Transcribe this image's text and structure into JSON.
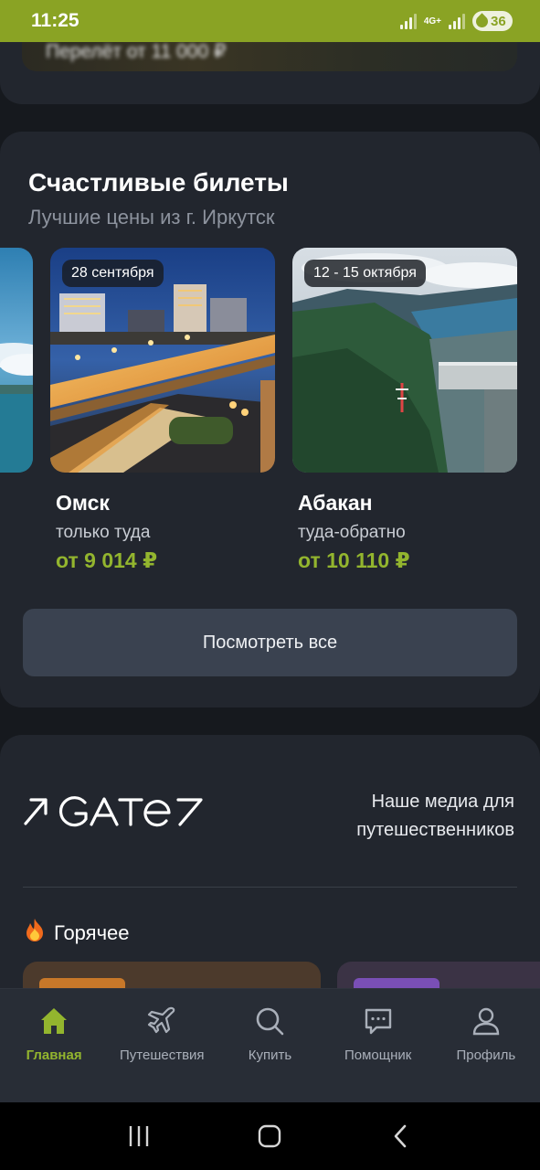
{
  "status_bar": {
    "time": "11:25",
    "network": "4G+",
    "battery": "36",
    "bg_color": "#8aa324"
  },
  "top_banner": {
    "text": "Перелёт от 11 000 ₽"
  },
  "lucky_tickets": {
    "title": "Счастливые билеты",
    "subtitle": "Лучшие цены из г. Иркутск",
    "tickets": [
      {
        "date": "28 сентября",
        "city": "Омск",
        "type": "только туда",
        "price": "от 9 014 ₽"
      },
      {
        "date": "12 - 15 октября",
        "city": "Абакан",
        "type": "туда-обратно",
        "price": "от 10 110 ₽"
      }
    ],
    "see_all_label": "Посмотреть все",
    "price_color": "#93b52e"
  },
  "gate": {
    "logo_text": "GATE",
    "tagline_line1": "Наше медиа для",
    "tagline_line2": "путешественников",
    "hot_label": "Горячее",
    "hot_icon": "fire-icon"
  },
  "bottom_nav": {
    "items": [
      {
        "label": "Главная",
        "icon": "home-icon",
        "active": true
      },
      {
        "label": "Путешествия",
        "icon": "plane-icon",
        "active": false
      },
      {
        "label": "Купить",
        "icon": "search-icon",
        "active": false
      },
      {
        "label": "Помощник",
        "icon": "chat-icon",
        "active": false
      },
      {
        "label": "Профиль",
        "icon": "profile-icon",
        "active": false
      }
    ],
    "active_color": "#93b52e"
  },
  "system_nav": {
    "icons": [
      "recents-icon",
      "home-button-icon",
      "back-icon"
    ]
  }
}
